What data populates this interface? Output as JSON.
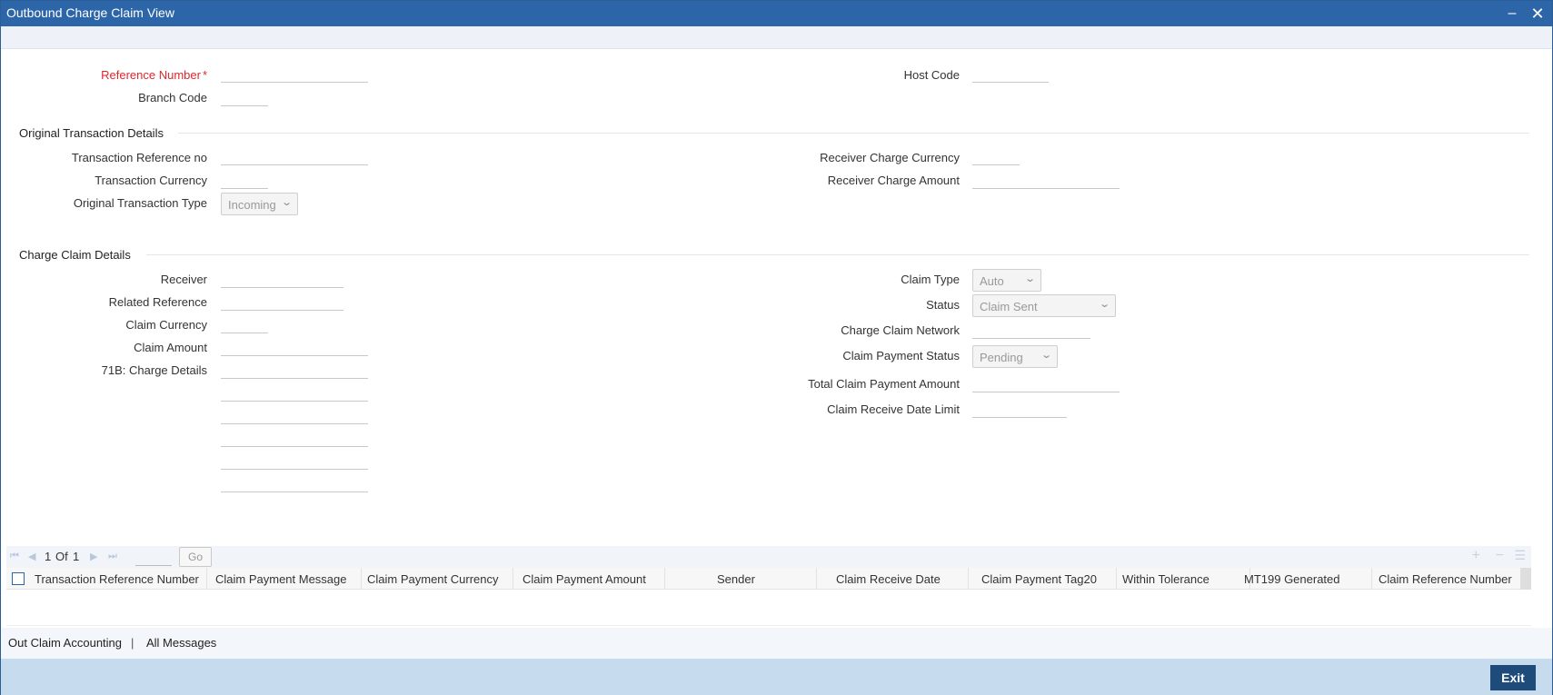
{
  "window": {
    "title": "Outbound Charge Claim View"
  },
  "header_fields": {
    "reference_number_label": "Reference Number",
    "reference_number_value": "",
    "branch_code_label": "Branch Code",
    "branch_code_value": "",
    "host_code_label": "Host Code",
    "host_code_value": ""
  },
  "original_transaction": {
    "title": "Original Transaction Details",
    "txn_ref_label": "Transaction Reference no",
    "txn_ref_value": "",
    "txn_currency_label": "Transaction Currency",
    "txn_currency_value": "",
    "orig_txn_type_label": "Original Transaction Type",
    "orig_txn_type_value": "Incoming",
    "recv_charge_currency_label": "Receiver Charge Currency",
    "recv_charge_currency_value": "",
    "recv_charge_amount_label": "Receiver Charge Amount",
    "recv_charge_amount_value": ""
  },
  "charge_claim": {
    "title": "Charge Claim Details",
    "receiver_label": "Receiver",
    "receiver_value": "",
    "related_ref_label": "Related Reference",
    "related_ref_value": "",
    "claim_currency_label": "Claim Currency",
    "claim_currency_value": "",
    "claim_amount_label": "Claim Amount",
    "claim_amount_value": "",
    "charge_details_label": "71B: Charge Details",
    "charge_details_lines": [
      "",
      "",
      "",
      "",
      "",
      ""
    ],
    "claim_type_label": "Claim Type",
    "claim_type_value": "Auto",
    "status_label": "Status",
    "status_value": "Claim Sent",
    "network_label": "Charge Claim Network",
    "network_value": "",
    "payment_status_label": "Claim Payment Status",
    "payment_status_value": "Pending",
    "total_payment_label": "Total Claim Payment Amount",
    "total_payment_value": "",
    "receive_date_limit_label": "Claim Receive Date Limit",
    "receive_date_limit_value": ""
  },
  "grid": {
    "pager": {
      "current": "1",
      "of_label": "Of",
      "total": "1",
      "go_label": "Go"
    },
    "columns": [
      "Transaction Reference Number",
      "Claim Payment Message",
      "Claim Payment Currency",
      "Claim Payment Amount",
      "Sender",
      "Claim Receive Date",
      "Claim Payment Tag20",
      "Within Tolerance",
      "MT199 Generated",
      "Claim Reference Number"
    ],
    "rows": []
  },
  "footer": {
    "links": [
      "Out Claim Accounting",
      "All Messages"
    ],
    "separator": "|",
    "exit_label": "Exit"
  },
  "colors": {
    "titlebar": "#2d66a8",
    "required": "#e0262d",
    "exit_button": "#1f4b7a",
    "bottom_bar": "#c6dcee"
  }
}
